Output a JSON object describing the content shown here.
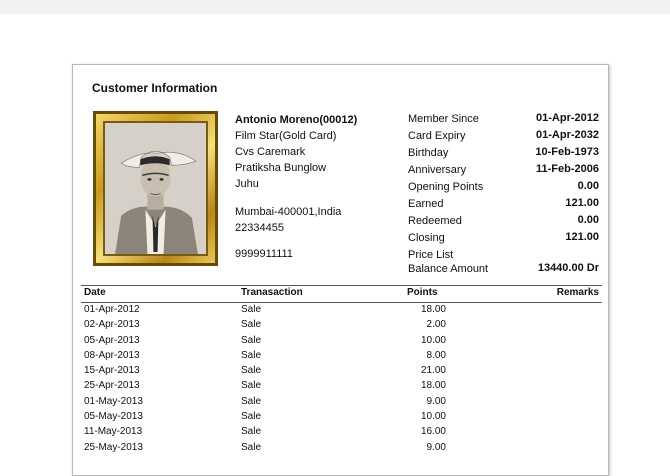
{
  "title": "Customer Information",
  "customer": {
    "name": "Antonio Moreno(00012)",
    "card_type": "Film Star(Gold Card)",
    "address": [
      "Cvs Caremark",
      "Pratiksha Bunglow",
      "Juhu"
    ],
    "city": "Mumbai-400001,India",
    "phone": "22334455",
    "mobile": "9999911111"
  },
  "stats": [
    {
      "label": "Member Since",
      "value": "01-Apr-2012"
    },
    {
      "label": "Card Expiry",
      "value": "01-Apr-2032"
    },
    {
      "label": "Birthday",
      "value": "10-Feb-1973"
    },
    {
      "label": "Anniversary",
      "value": "11-Feb-2006"
    },
    {
      "label": "Opening Points",
      "value": "0.00"
    },
    {
      "label": "Earned",
      "value": "121.00"
    },
    {
      "label": "Redeemed",
      "value": "0.00"
    },
    {
      "label": "Closing",
      "value": "121.00"
    },
    {
      "label": "Price List",
      "value": ""
    },
    {
      "label": "Balance Amount",
      "value": "13440.00 Dr"
    }
  ],
  "table": {
    "headers": {
      "date": "Date",
      "transaction": "Tranasaction",
      "points": "Points",
      "remarks": "Remarks"
    },
    "rows": [
      {
        "date": "01-Apr-2012",
        "transaction": "Sale",
        "points": "18.00",
        "remarks": ""
      },
      {
        "date": "02-Apr-2013",
        "transaction": "Sale",
        "points": "2.00",
        "remarks": ""
      },
      {
        "date": "05-Apr-2013",
        "transaction": "Sale",
        "points": "10.00",
        "remarks": ""
      },
      {
        "date": "08-Apr-2013",
        "transaction": "Sale",
        "points": "8.00",
        "remarks": ""
      },
      {
        "date": "15-Apr-2013",
        "transaction": "Sale",
        "points": "21.00",
        "remarks": ""
      },
      {
        "date": "25-Apr-2013",
        "transaction": "Sale",
        "points": "18.00",
        "remarks": ""
      },
      {
        "date": "01-May-2013",
        "transaction": "Sale",
        "points": "9.00",
        "remarks": ""
      },
      {
        "date": "05-May-2013",
        "transaction": "Sale",
        "points": "10.00",
        "remarks": ""
      },
      {
        "date": "11-May-2013",
        "transaction": "Sale",
        "points": "16.00",
        "remarks": ""
      },
      {
        "date": "25-May-2013",
        "transaction": "Sale",
        "points": "9.00",
        "remarks": ""
      }
    ]
  }
}
